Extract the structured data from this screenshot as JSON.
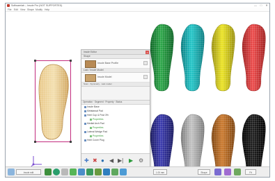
{
  "window": {
    "title": "Softwarelab – Insole Pro (NOT SUPPORTED)",
    "controls": [
      "—",
      "□",
      "✕"
    ]
  },
  "menubar": {
    "items": [
      "File",
      "Edit",
      "View",
      "Shape",
      "Modify",
      "Help"
    ]
  },
  "panel": {
    "title": "Insole Editor",
    "section_top": "Shape",
    "base_row": {
      "label": "Insole Base Profile",
      "icon": "insole-thumbnail-icon"
    },
    "section_mid": "Last / Insole Model",
    "model_row": {
      "label": "Insole Model",
      "icon": "insole-thumbnail-icon"
    },
    "mid_options": [
      "Scan",
      "Symmetry",
      "Last model"
    ],
    "tree_header": "Operation · Segment · Property · Status",
    "tree_items": [
      {
        "label": "Insole Base",
        "color": "#444"
      },
      {
        "label": "Metatarsal Pad",
        "color": "#444"
      },
      {
        "label": "Heel Cup & Post 3%",
        "color": "#444"
      },
      {
        "label": "Properties",
        "color": "#3a9a3a"
      },
      {
        "label": "Medial Arch Pad",
        "color": "#444"
      },
      {
        "label": "Properties",
        "color": "#3a9a3a"
      },
      {
        "label": "Lateral Wedge Pad",
        "color": "#444"
      },
      {
        "label": "Properties",
        "color": "#3a9a3a"
      },
      {
        "label": "Heel Cover Plug",
        "color": "#444"
      }
    ],
    "tools": [
      "add-icon",
      "delete-icon",
      "info-icon",
      "play-reverse-icon",
      "step-icon",
      "play-icon",
      "settings-icon"
    ]
  },
  "insoles": [
    {
      "name": "green",
      "color": "#2ea84a",
      "shade": "#0c6424"
    },
    {
      "name": "cyan",
      "color": "#24c7c9",
      "shade": "#0b7c80"
    },
    {
      "name": "yellow",
      "color": "#ece424",
      "shade": "#99900f"
    },
    {
      "name": "red",
      "color": "#ee4c4c",
      "shade": "#9f1f1f"
    },
    {
      "name": "blue",
      "color": "#3c3cb0",
      "shade": "#17175f"
    },
    {
      "name": "silver",
      "color": "#c4c4c4",
      "shade": "#7b7b7b"
    },
    {
      "name": "orange",
      "color": "#cc7a2e",
      "shade": "#7d4410"
    },
    {
      "name": "black",
      "color": "#222222",
      "shade": "#000000"
    }
  ],
  "toolbar": {
    "left_box": "Insole edit",
    "middle_box": "1.00 mm",
    "right_box_1": "Shape",
    "right_box_2": "Fit"
  }
}
